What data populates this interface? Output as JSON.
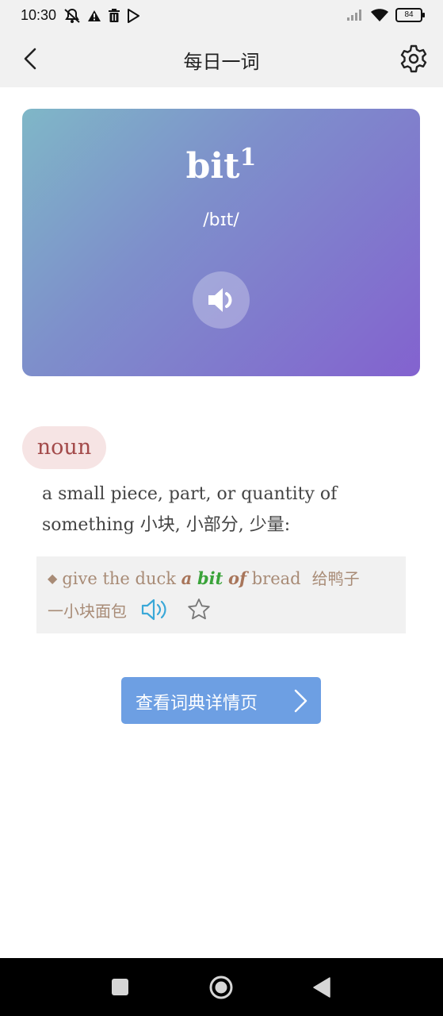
{
  "status_bar": {
    "time": "10:30",
    "battery": "84",
    "left_icons": [
      "mute-bell-icon",
      "alert-icon",
      "trash-icon",
      "play-store-icon"
    ],
    "right_icons": [
      "signal-icon",
      "wifi-icon",
      "battery-icon"
    ]
  },
  "app_bar": {
    "title": "每日一词",
    "back_icon": "chevron-left-icon",
    "settings_icon": "gear-icon"
  },
  "word_card": {
    "headword": "bit",
    "superscript": "1",
    "phonetic": "/bɪt/",
    "speaker_icon": "speaker-icon",
    "gradient": [
      "#7fb7c7",
      "#8362cf"
    ]
  },
  "entry": {
    "part_of_speech": "noun",
    "definition_en": "a small piece, part, or quantity of something",
    "definition_zh": "小块, 小部分, 少量:"
  },
  "example": {
    "bullet": "◆",
    "text_before": "give the duck ",
    "kw_a": "a",
    "kw_bit": "bit",
    "kw_of": "of",
    "text_after": "bread",
    "translation_part1": "给鸭子",
    "translation_part2": "一小块面包",
    "speaker_icon": "speaker-wave-icon",
    "star_icon": "star-outline-icon"
  },
  "dictionary_button": {
    "label": "查看词典详情页",
    "color": "#6d9fe3"
  },
  "nav_bar": {
    "icons": [
      "recents-square-icon",
      "home-circle-icon",
      "back-triangle-icon"
    ]
  }
}
